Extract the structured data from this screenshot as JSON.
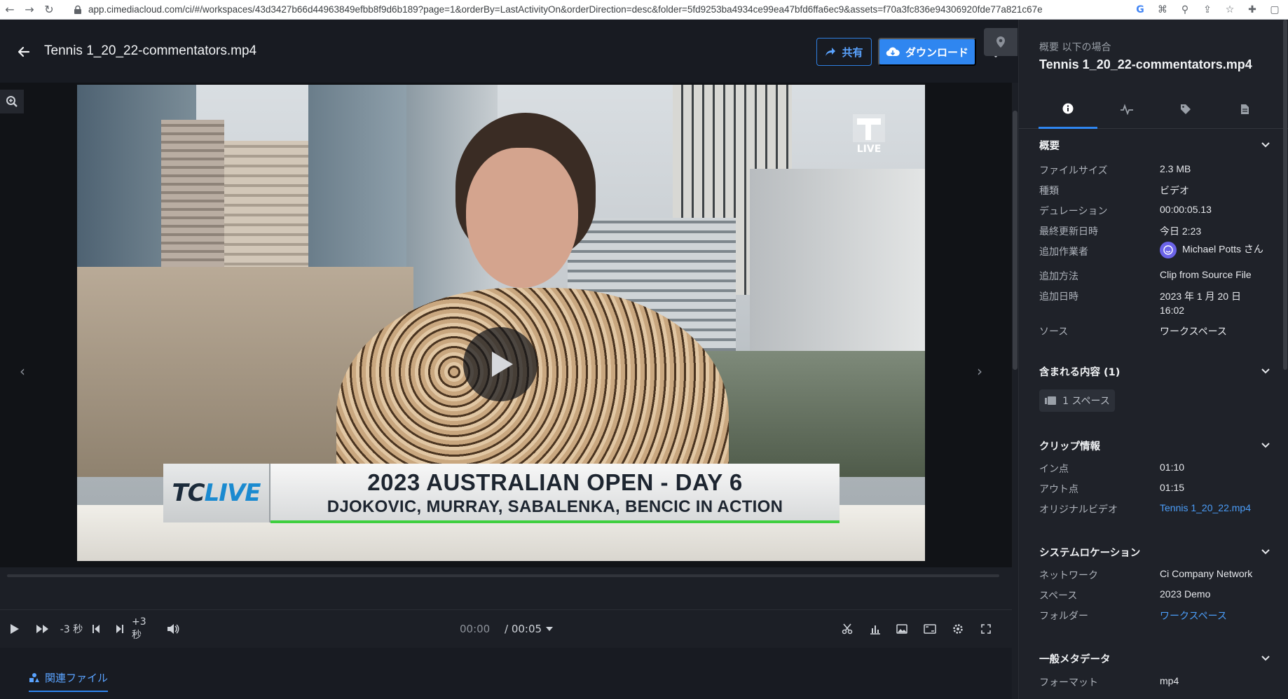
{
  "browser": {
    "url": "app.cimediacloud.com/ci/#/workspaces/43d3427b66d44963849efbb8f9d6b189?page=1&orderBy=LastActivityOn&orderDirection=desc&folder=5fd9253ba4934ce99ea47bfd6ffa6ec9&assets=f70a3fc836e94306920fde77a821c67e"
  },
  "header": {
    "title": "Tennis 1_20_22-commentators.mp4",
    "share_label": "共有",
    "download_label": "ダウンロード"
  },
  "video": {
    "live_label": "LIVE",
    "lower_third": {
      "logo_tc": "TC",
      "logo_live": "LIVE",
      "line1": "2023 AUSTRALIAN OPEN - DAY 6",
      "line2": "DJOKOVIC, MURRAY, SABALENKA, BENCIC IN ACTION"
    }
  },
  "controls": {
    "rewind_label": "-3 秒",
    "forward_label": "+3 秒",
    "time_current": "00:00",
    "time_total": "/ 00:05"
  },
  "bottom": {
    "related_tab": "関連ファイル"
  },
  "panel": {
    "subtitle": "概要 以下の場合",
    "title": "Tennis 1_20_22-commentators.mp4",
    "overview": {
      "heading": "概要",
      "rows": [
        {
          "label": "ファイルサイズ",
          "value": "2.3 MB"
        },
        {
          "label": "種類",
          "value": "ビデオ"
        },
        {
          "label": "デュレーション",
          "value": "00:00:05.13"
        },
        {
          "label": "最終更新日時",
          "value": "今日 2:23"
        },
        {
          "label": "追加作業者",
          "value": "Michael Potts さん"
        },
        {
          "label": "追加方法",
          "value": "Clip from Source File"
        },
        {
          "label": "追加日時",
          "value": "2023 年 1 月 20 日",
          "value2": "16:02"
        },
        {
          "label": "ソース",
          "value": "ワークスペース"
        }
      ]
    },
    "contents": {
      "heading": "含まれる内容 (1)",
      "chip": "1 スペース"
    },
    "clip": {
      "heading": "クリップ情報",
      "rows": [
        {
          "label": "イン点",
          "value": "01:10"
        },
        {
          "label": "アウト点",
          "value": "01:15"
        },
        {
          "label": "オリジナルビデオ",
          "value": "Tennis 1_20_22.mp4"
        }
      ]
    },
    "location": {
      "heading": "システムロケーション",
      "rows": [
        {
          "label": "ネットワーク",
          "value": "Ci Company Network"
        },
        {
          "label": "スペース",
          "value": "2023 Demo"
        },
        {
          "label": "フォルダー",
          "value": "ワークスペース"
        }
      ]
    },
    "general": {
      "heading": "一般メタデータ",
      "rows": [
        {
          "label": "フォーマット",
          "value": "mp4"
        }
      ]
    }
  },
  "colors": {
    "accent": "#2f86f0",
    "link": "#4b9df8",
    "background": "#1c1f26"
  }
}
